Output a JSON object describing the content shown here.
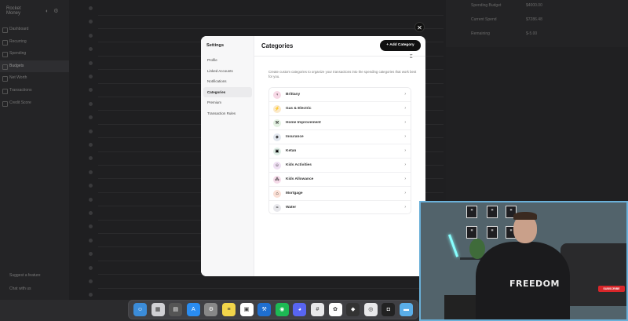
{
  "background_app": {
    "nav_items": [
      "Dashboard",
      "Recurring",
      "Spending",
      "Budgets",
      "Net Worth",
      "Transactions",
      "Credit Score"
    ],
    "active_nav": "Budgets",
    "footer": [
      "Suggest a feature",
      "Chat with us"
    ],
    "stats": [
      {
        "label": "Spending Budget",
        "value": "$4000.00"
      },
      {
        "label": "Current Spend",
        "value": "$7286.48"
      },
      {
        "label": "Remaining",
        "value": "$-5.00"
      }
    ]
  },
  "settings": {
    "title": "Settings",
    "nav": [
      "Profile",
      "Linked Accounts",
      "Notifications",
      "Categories",
      "Premium",
      "Transaction Rules"
    ],
    "active": "Categories"
  },
  "main": {
    "title": "Categories",
    "add_button": "+ Add Category",
    "description": "Create custom categories to organize your transactions into the spending categories that work best for you."
  },
  "categories": [
    {
      "label": "Brittany",
      "icon": "bag-icon",
      "color": "#f7d9e6",
      "glyph": "♀"
    },
    {
      "label": "Gas & Electric",
      "icon": "bolt-icon",
      "color": "#fbe9c9",
      "glyph": "⚡"
    },
    {
      "label": "Home Improvement",
      "icon": "hammer-icon",
      "color": "#e3f1e2",
      "glyph": "⚒"
    },
    {
      "label": "Insurance",
      "icon": "shield-icon",
      "color": "#e2e7ee",
      "glyph": "◈"
    },
    {
      "label": "Ketan",
      "icon": "monitor-icon",
      "color": "#dfeee6",
      "glyph": "▣"
    },
    {
      "label": "Kids Activities",
      "icon": "kids-icon",
      "color": "#efe0f3",
      "glyph": "☺"
    },
    {
      "label": "Kids Allowance",
      "icon": "coins-icon",
      "color": "#f6dcea",
      "glyph": "⁂"
    },
    {
      "label": "Mortgage",
      "icon": "house-icon",
      "color": "#fbe0d6",
      "glyph": "⌂"
    },
    {
      "label": "Water",
      "icon": "water-icon",
      "color": "#e8e8ec",
      "glyph": "≈"
    }
  ],
  "webcam": {
    "shirt_text": "FREEDOM",
    "subscribe": "SUBSCRIBE"
  }
}
